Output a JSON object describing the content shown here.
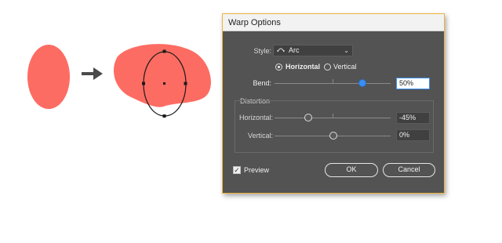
{
  "colors": {
    "shape_fill": "#fd6c62",
    "dialog_bg": "#535353",
    "accent_blue": "#3a8ff0",
    "dialog_border": "#f0b33a"
  },
  "artwork": {
    "arrow_icon": "right-arrow-icon"
  },
  "dialog": {
    "title": "Warp Options",
    "style": {
      "label": "Style:",
      "icon": "arc-icon",
      "value": "Arc"
    },
    "orientation": {
      "horizontal_label": "Horizontal",
      "vertical_label": "Vertical",
      "selected": "Horizontal"
    },
    "bend": {
      "label": "Bend:",
      "value": "50%",
      "percent": 50
    },
    "distortion": {
      "title": "Distortion",
      "horizontal": {
        "label": "Horizontal:",
        "value": "-45%",
        "percent": -45
      },
      "vertical": {
        "label": "Vertical:",
        "value": "0%",
        "percent": 0
      }
    },
    "preview": {
      "label": "Preview",
      "checked": true
    },
    "ok_label": "OK",
    "cancel_label": "Cancel"
  }
}
